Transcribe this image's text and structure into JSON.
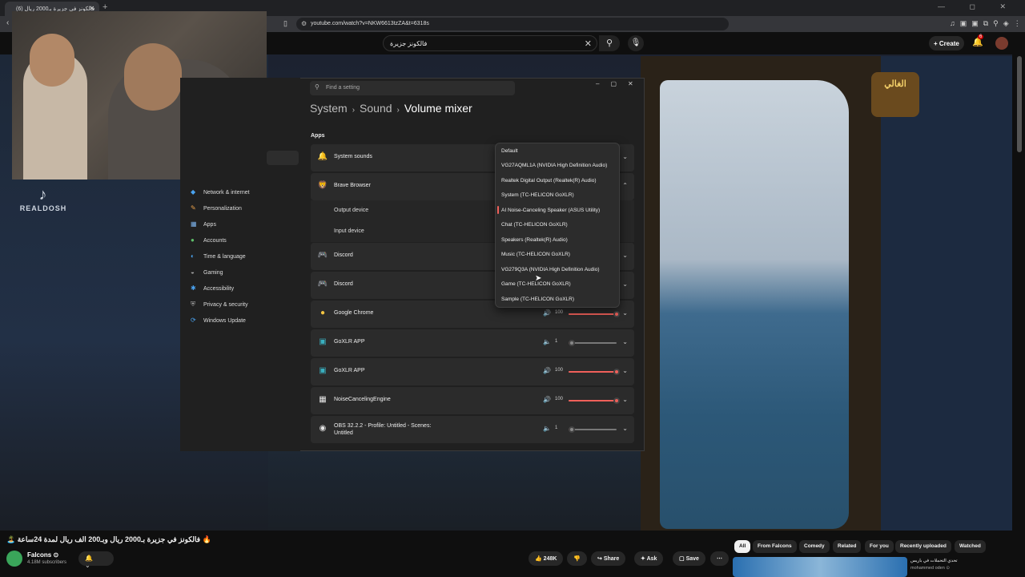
{
  "browser": {
    "tab_title": "(6) فالكونز في جزيرة بـ2000 ريال",
    "url": "youtube.com/watch?v=NKW6613tzZA&t=6318s",
    "window_controls": "— ◻ ✕"
  },
  "youtube": {
    "search_value": "فالكونز جزيرة",
    "create_label": "Create",
    "notification_count": "6",
    "video_title": "🔥 فالكونز في جزيرة بـ2000 ريال وبـ200 الف ريال لمدة 24ساعة 🏝️",
    "channel_name": "Falcons ⊙",
    "channel_subs": "4.18M subscribers",
    "like_count": "248K",
    "share_label": "Share",
    "ask_label": "Ask",
    "save_label": "Save",
    "chips": [
      "All",
      "From Falcons",
      "Comedy",
      "Related",
      "For you",
      "Recently uploaded",
      "Watched"
    ],
    "suggested_title": "تحدي التحملات في باريس",
    "suggested_channel": "mohammed oden ⊙"
  },
  "overlay": {
    "tiktok_handle": "REALDOSH",
    "logo_right": "الغالي"
  },
  "settings": {
    "search_placeholder": "Find a setting",
    "breadcrumb": [
      "System",
      "Sound",
      "Volume mixer"
    ],
    "apps_heading": "Apps",
    "nav": [
      "Network & internet",
      "Personalization",
      "Apps",
      "Accounts",
      "Time & language",
      "Gaming",
      "Accessibility",
      "Privacy & security",
      "Windows Update"
    ],
    "rows": [
      {
        "name": "System sounds",
        "icon": "🔔"
      },
      {
        "name": "Brave Browser",
        "icon": "🦁"
      },
      {
        "name": "Discord",
        "icon": "🎮"
      },
      {
        "name": "Discord",
        "icon": "🎮"
      },
      {
        "name": "Google Chrome",
        "icon": "●",
        "value": "100",
        "level": 1.0
      },
      {
        "name": "GoXLR APP",
        "icon": "▣",
        "value": "1",
        "level": 0.01
      },
      {
        "name": "GoXLR APP",
        "icon": "▣",
        "value": "100",
        "level": 1.0
      },
      {
        "name": "NoiseCancelingEngine",
        "icon": "▦",
        "value": "100",
        "level": 1.0
      },
      {
        "name": "OBS 32.2.2 - Profile: Untitled - Scenes: Untitled",
        "icon": "◉",
        "value": "1",
        "level": 0.01
      }
    ],
    "subrows": [
      "Output device",
      "Input device"
    ],
    "dropdown": [
      "Default",
      "VG27AQML1A (NVIDIA High Definition Audio)",
      "Realtek Digital Output (Realtek(R) Audio)",
      "System (TC-HELICON GoXLR)",
      "AI Noise-Canceling Speaker (ASUS Utility)",
      "Chat (TC-HELICON GoXLR)",
      "Speakers (Realtek(R) Audio)",
      "Music (TC-HELICON GoXLR)",
      "VG279Q3A (NVIDIA High Definition Audio)",
      "Game (TC-HELICON GoXLR)",
      "Sample (TC-HELICON GoXLR)"
    ],
    "dropdown_selected": "AI Noise-Canceling Speaker (ASUS Utility)"
  },
  "colors": {
    "accent": "#f0605a",
    "yt_red": "#cc0000"
  }
}
